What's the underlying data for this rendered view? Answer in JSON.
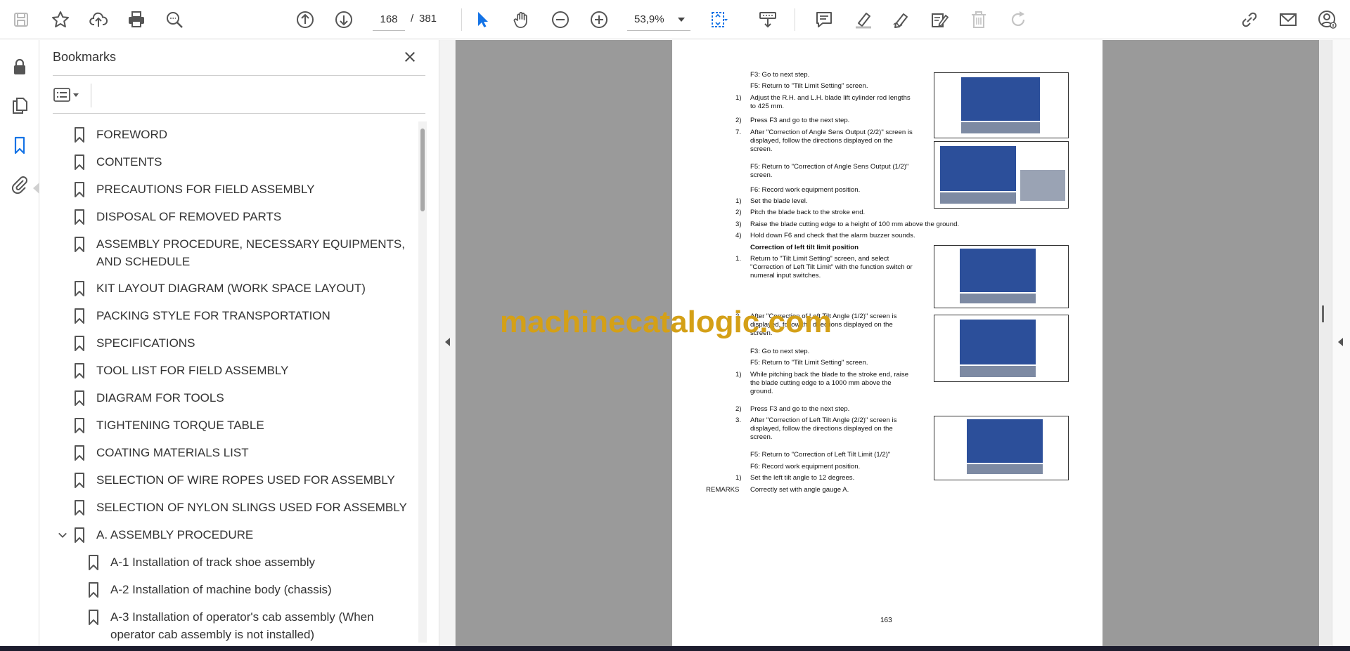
{
  "toolbar": {
    "page_current": "168",
    "page_separator": "/",
    "page_total": "381",
    "zoom": "53,9%"
  },
  "panel": {
    "title": "Bookmarks"
  },
  "bookmarks": [
    {
      "label": "FOREWORD"
    },
    {
      "label": "CONTENTS"
    },
    {
      "label": "PRECAUTIONS FOR FIELD ASSEMBLY"
    },
    {
      "label": "DISPOSAL OF REMOVED PARTS"
    },
    {
      "label": "ASSEMBLY PROCEDURE, NECESSARY EQUIPMENTS, AND SCHEDULE"
    },
    {
      "label": "KIT LAYOUT DIAGRAM (WORK SPACE LAYOUT)"
    },
    {
      "label": "PACKING STYLE FOR TRANSPORTATION"
    },
    {
      "label": "SPECIFICATIONS"
    },
    {
      "label": "TOOL LIST FOR FIELD ASSEMBLY"
    },
    {
      "label": "DIAGRAM FOR TOOLS"
    },
    {
      "label": "TIGHTENING TORQUE TABLE"
    },
    {
      "label": "COATING MATERIALS LIST"
    },
    {
      "label": "SELECTION OF WIRE ROPES USED FOR ASSEMBLY"
    },
    {
      "label": "SELECTION OF NYLON SLINGS USED FOR ASSEMBLY"
    },
    {
      "label": "A. ASSEMBLY PROCEDURE"
    },
    {
      "label": "A-1 Installation of track shoe assembly"
    },
    {
      "label": "A-2 Installation of machine body (chassis)"
    },
    {
      "label": "A-3 Installation of operator's cab assembly (When operator cab assembly is not installed)"
    }
  ],
  "doc": {
    "lines": [
      {
        "n": "",
        "t": "F3: Go to next step."
      },
      {
        "n": "",
        "t": "F5: Return to \"Tilt Limit Setting\" screen."
      },
      {
        "n": "1)",
        "t": "Adjust the R.H. and L.H. blade lift cylinder rod lengths to 425 mm."
      },
      {
        "n": "2)",
        "t": "Press F3 and go to the next step."
      },
      {
        "n": "7.",
        "t": "After \"Correction of Angle Sens Output (2/2)\" screen is displayed, follow the directions displayed on the screen."
      },
      {
        "n": "",
        "t": "F5: Return to \"Correction of Angle Sens Output (1/2)\" screen."
      },
      {
        "n": "",
        "t": "F6: Record work equipment position."
      },
      {
        "n": "1)",
        "t": "Set the blade level."
      },
      {
        "n": "2)",
        "t": "Pitch the blade back to the stroke end."
      },
      {
        "n": "3)",
        "t": "Raise the blade cutting edge to a height of 100 mm above the ground."
      },
      {
        "n": "4)",
        "t": "Hold down F6 and check that the alarm buzzer sounds."
      },
      {
        "n": "",
        "t": "Correction of left tilt limit position"
      },
      {
        "n": "1.",
        "t": "Return to \"Tilt Limit Setting\" screen, and select \"Correction of Left Tilt Limit\" with the function switch or numeral input switches."
      },
      {
        "n": "2.",
        "t": "After \"Correction of Left Tilt Angle (1/2)\" screen is displayed, follow the directions displayed on the screen."
      },
      {
        "n": "",
        "t": "F3: Go to next step."
      },
      {
        "n": "",
        "t": "F5: Return to \"Tilt Limit Setting\" screen."
      },
      {
        "n": "1)",
        "t": "While pitching back the blade to the stroke end, raise the blade cutting edge to a 1000 mm above the ground."
      },
      {
        "n": "2)",
        "t": "Press F3 and go to the next step."
      },
      {
        "n": "3.",
        "t": "After \"Correction of Left Tilt Angle (2/2)\" screen is displayed, follow the directions displayed on the screen."
      },
      {
        "n": "",
        "t": "F5: Return to \"Correction of Left Tilt Limit (1/2)\""
      },
      {
        "n": "",
        "t": "F6: Record work equipment position."
      },
      {
        "n": "1)",
        "t": "Set the left tilt angle to 12 degrees."
      },
      {
        "n": "REMARKS",
        "t": "Correctly set with angle gauge A."
      }
    ],
    "page_number": "163",
    "watermark": "machinecatalogic.com"
  },
  "icons": {
    "save": "save-icon",
    "bookmark_star": "star-icon",
    "upload": "upload-cloud-icon",
    "print": "print-icon",
    "find": "search-zoom-icon",
    "prev_page": "arrow-up-circle-icon",
    "next_page": "arrow-down-circle-icon",
    "zoom_out": "minus-circle-icon",
    "zoom_in": "plus-circle-icon",
    "select": "cursor-arrow-icon",
    "hand": "hand-icon",
    "accent": "#1473e6"
  }
}
